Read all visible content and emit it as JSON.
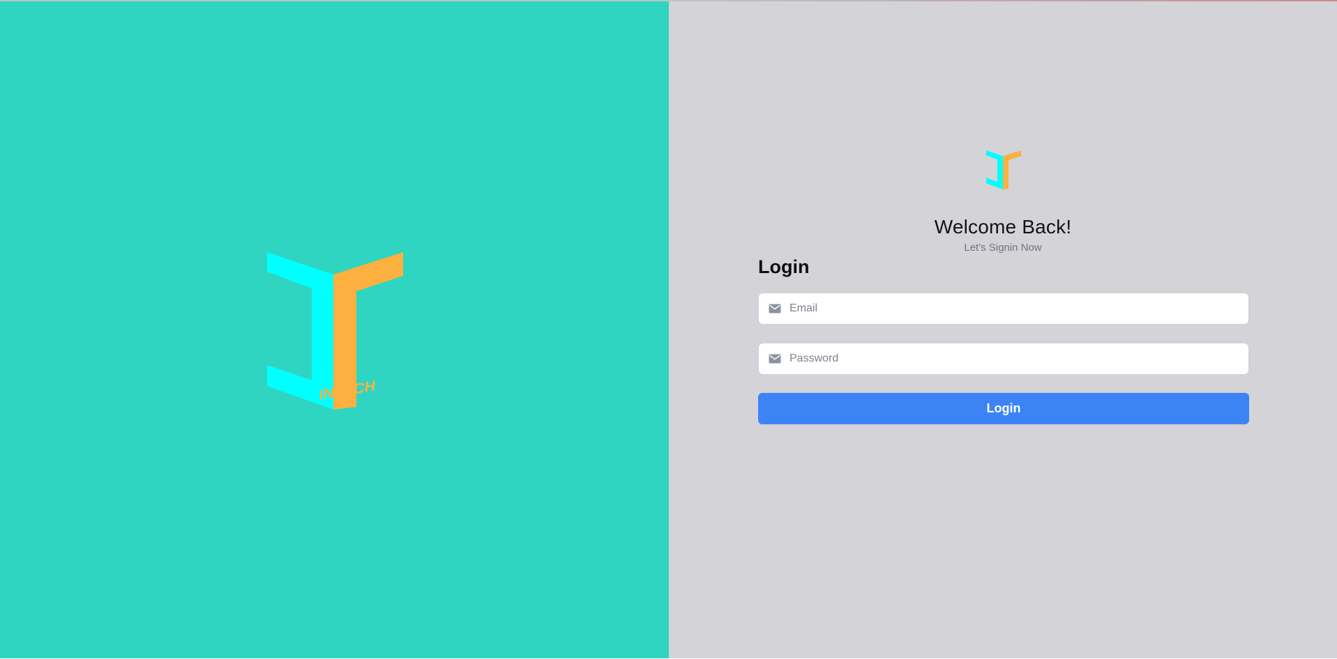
{
  "branding": {
    "logo_text": "INTECH",
    "colors": {
      "left_panel": "#2fd5c1",
      "right_panel": "#d4d3d8",
      "cyan": "#00ffff",
      "orange": "#fbb040",
      "button": "#3c84f6",
      "text_primary": "#111318",
      "text_secondary": "#6f7480"
    }
  },
  "header": {
    "title": "Welcome Back!",
    "subtitle": "Let's Signin Now"
  },
  "form": {
    "heading": "Login",
    "email": {
      "placeholder": "Email",
      "value": "",
      "icon": "mail-icon"
    },
    "password": {
      "placeholder": "Password",
      "value": "",
      "icon": "mail-icon"
    },
    "submit_label": "Login"
  }
}
